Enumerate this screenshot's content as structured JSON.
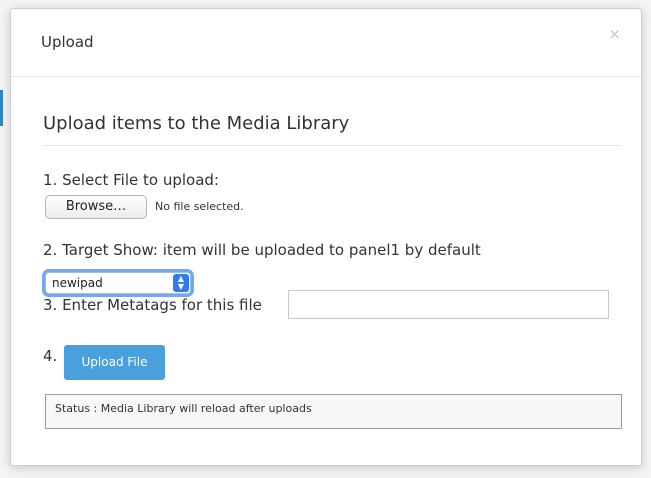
{
  "dialog": {
    "title": "Upload",
    "close_glyph": "×"
  },
  "form": {
    "heading": "Upload items to the Media Library",
    "step1_label": "1. Select File to upload:",
    "browse_button_label": "Browse…",
    "no_file_text": "No file selected.",
    "step2_label": "2. Target Show: item will be uploaded to panel1 by default",
    "target_show_selected": "newipad",
    "step3_label": "3. Enter Metatags for this file",
    "metatags_value": "",
    "step4_label": "4.",
    "upload_button_label": "Upload File",
    "status_text": "Status : Media Library will reload after uploads"
  },
  "colors": {
    "accent": "#49a0dc",
    "focus_ring": "#76a7ea",
    "select_arrow": "#2f7cf1"
  },
  "icons": {
    "close": "close-icon",
    "select_arrows": "chevron-up-down-icon"
  }
}
